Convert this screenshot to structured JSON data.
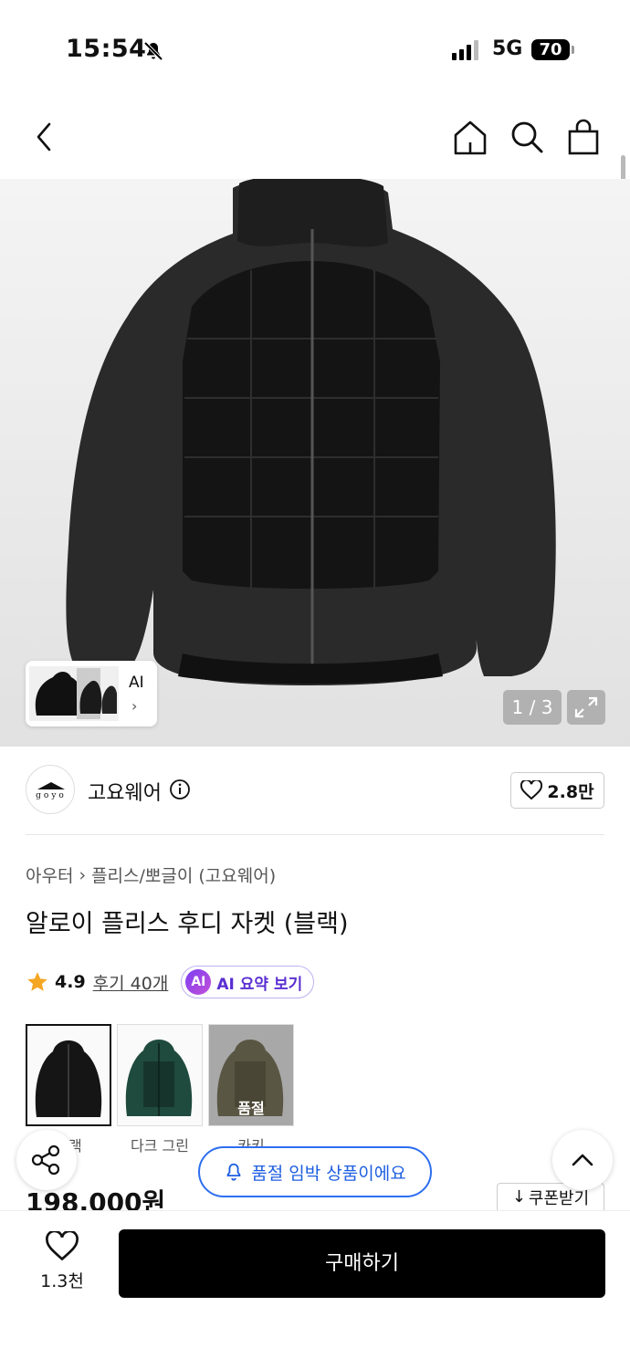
{
  "status_bar": {
    "time": "15:54",
    "network": "5G",
    "battery": "70"
  },
  "gallery": {
    "ai_label": "AI",
    "counter": "1 / 3"
  },
  "brand": {
    "name": "고요웨어",
    "logo_text": "goyo",
    "likes": "2.8만"
  },
  "breadcrumb": {
    "category": "아우터",
    "subcategory": "플리스/뽀글이 (고요웨어)"
  },
  "product": {
    "title": "알로이 플리스 후디 자켓 (블랙)",
    "price": "198,000원"
  },
  "rating": {
    "score": "4.9",
    "reviews": "후기 40개",
    "ai_badge": "AI",
    "ai_summary": "AI 요약 보기"
  },
  "variants": [
    {
      "label": "블랙",
      "color": "#1a1a1a",
      "sold_out": ""
    },
    {
      "label": "다크 그린",
      "color": "#1f4a3e",
      "sold_out": ""
    },
    {
      "label": "카키",
      "color": "#5a5644",
      "sold_out": "품절"
    }
  ],
  "toast": {
    "text": "품절 임박 상품이에요"
  },
  "coupon": {
    "label": "쿠폰받기"
  },
  "bottom": {
    "wish_count": "1.3천",
    "buy_label": "구매하기"
  },
  "colors": {
    "accent_blue": "#2d6ef0",
    "ai_purple": "#5a2fd1",
    "buy_button": "#000000"
  }
}
